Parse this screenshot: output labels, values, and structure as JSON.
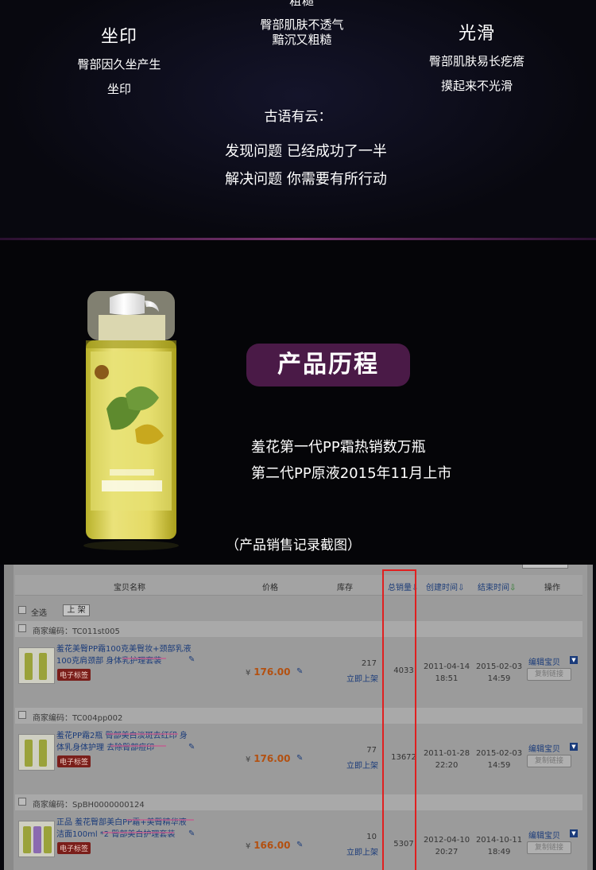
{
  "top": {
    "col1": {
      "heading": "坐印",
      "lines": [
        "臀部因久坐产生",
        "坐印"
      ]
    },
    "col2": {
      "lines": [
        "粗糙",
        "臀部肌肤不透气",
        "黯沉又粗糙"
      ]
    },
    "col3": {
      "heading": "光滑",
      "lines": [
        "臀部肌肤易长疙瘩",
        "摸起来不光滑"
      ]
    },
    "saying_title": "古语有云：",
    "saying_line1": "发现问题 已经成功了一半",
    "saying_line2": "解决问题 你需要有所行动"
  },
  "product": {
    "badge": "产品历程",
    "line1": "羞花第一代PP霜热销数万瓶",
    "line2": "第二代PP原液2015年11月上市",
    "caption": "（产品销售记录截图）"
  },
  "table": {
    "headers": {
      "name": "宝贝名称",
      "price": "价格",
      "stock": "库存",
      "sales": "总销量",
      "created": "创建时间",
      "ended": "结束时间",
      "ops": "操作"
    },
    "select_all": "全选",
    "shelf_button": "上 架",
    "groups": [
      {
        "code": "商家编码：TC011st005"
      },
      {
        "code": "商家编码：TC004pp002"
      },
      {
        "code": "商家编码：SpBH0000000124"
      }
    ],
    "items": [
      {
        "title_lines": [
          "羞花美臀PP霜100克美臀妆+颈部乳液",
          "100克肩颈部 身体乳护理套装"
        ],
        "tag": "电子标签",
        "currency": "¥",
        "price": "176.00",
        "stock": "217",
        "stock_link": "立即上架",
        "sales": "4033",
        "created_date": "2011-04-14",
        "created_time": "18:51",
        "ended_date": "2015-02-03",
        "ended_time": "14:59",
        "op_edit": "编辑宝贝",
        "op_copy": "复制链接"
      },
      {
        "title_lines": [
          "羞花PP霜2瓶 臀部美白淡斑去红印 身",
          "体乳身体护理 去除臀部痘印"
        ],
        "tag": "电子标签",
        "currency": "¥",
        "price": "176.00",
        "stock": "77",
        "stock_link": "立即上架",
        "sales": "13672",
        "created_date": "2011-01-28",
        "created_time": "22:20",
        "ended_date": "2015-02-03",
        "ended_time": "14:59",
        "op_edit": "编辑宝贝",
        "op_copy": "复制链接"
      },
      {
        "title_lines": [
          "正品 羞花臀部美白PP霜+美臀精华液",
          "洁面100ml *2 臀部美白护理套装"
        ],
        "tag": "电子标签",
        "currency": "¥",
        "price": "166.00",
        "stock": "10",
        "stock_link": "立即上架",
        "sales": "5307",
        "created_date": "2012-04-10",
        "created_time": "20:27",
        "ended_date": "2014-10-11",
        "ended_time": "18:49",
        "op_edit": "编辑宝贝",
        "op_copy": "复制链接"
      }
    ]
  },
  "colors": {
    "badge": "#4a1a47",
    "highlight": "#e02020",
    "price": "#b35010",
    "link": "#1a3b7a"
  }
}
